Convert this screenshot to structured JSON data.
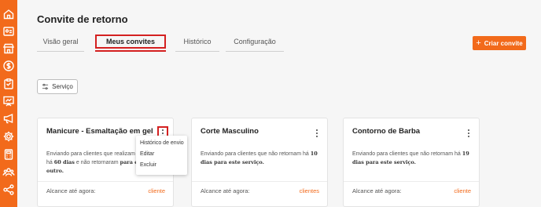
{
  "page": {
    "title": "Convite de retorno"
  },
  "tabs": [
    {
      "label": "Visão geral",
      "active": false
    },
    {
      "label": "Meus convites",
      "active": true
    },
    {
      "label": "Histórico",
      "active": false
    },
    {
      "label": "Configuração",
      "active": false
    }
  ],
  "actions": {
    "create_label": "Criar convite",
    "filter_label": "Serviço"
  },
  "dropdown": {
    "items": [
      "Histórico de envio",
      "Editar",
      "Excluir"
    ]
  },
  "cards": [
    {
      "title": "Manicure - Esmaltação em gel",
      "desc": {
        "p1": "Enviando para clientes que realizam e",
        "p2": "há ",
        "b1": "60 dias",
        "p3": " e não retornaram ",
        "b2": "para este",
        "b3": "outro."
      },
      "reach_label": "Alcance até agora:",
      "reach_value": "cliente"
    },
    {
      "title": "Corte Masculino",
      "desc": {
        "p1": "Enviando para clientes que não retornam há ",
        "b1": "10",
        "b2": "dias para este serviço."
      },
      "reach_label": "Alcance até agora:",
      "reach_value": "clientes"
    },
    {
      "title": "Contorno de Barba",
      "desc": {
        "p1": "Enviando para clientes que não retornam há ",
        "b1": "19",
        "b2": "dias para este serviço."
      },
      "reach_label": "Alcance até agora:",
      "reach_value": "cliente"
    }
  ],
  "sidebar": {
    "icons": [
      "home-icon",
      "id-card-icon",
      "store-icon",
      "dollar-icon",
      "clipboard-icon",
      "presentation-icon",
      "megaphone-icon",
      "settings-icon",
      "calculator-icon",
      "team-icon",
      "share-icon"
    ]
  },
  "colors": {
    "accent": "#f26a1b",
    "highlight": "#d42020",
    "sidebar": "#f26a1b"
  }
}
